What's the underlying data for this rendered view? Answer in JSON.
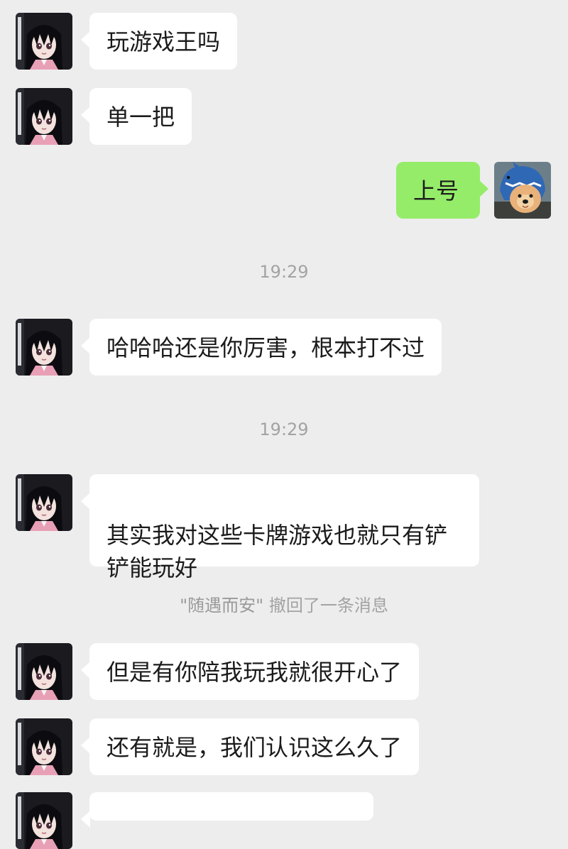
{
  "messages": [
    {
      "text": "玩游戏王吗"
    },
    {
      "text": "单一把"
    },
    {
      "text": "上号"
    },
    {
      "text": "哈哈哈还是你厉害，根本打不过"
    },
    {
      "text": "其实我对这些卡牌游戏也就只有铲\n铲能玩好"
    },
    {
      "text": "但是有你陪我玩我就很开心了"
    },
    {
      "text": "还有就是，我们认识这么久了"
    }
  ],
  "times": [
    "19:29",
    "19:29"
  ],
  "recall": {
    "name": "\"随遇而安\"",
    "text": " 撤回了一条消息"
  },
  "colors": {
    "background": "#ededed",
    "bubble_in": "#ffffff",
    "bubble_out": "#95ec69",
    "system_text": "#a3a3a3"
  },
  "icons": {
    "contact_avatar": "anime-girl-avatar-icon",
    "self_avatar": "dog-in-shark-hat-avatar-icon"
  }
}
